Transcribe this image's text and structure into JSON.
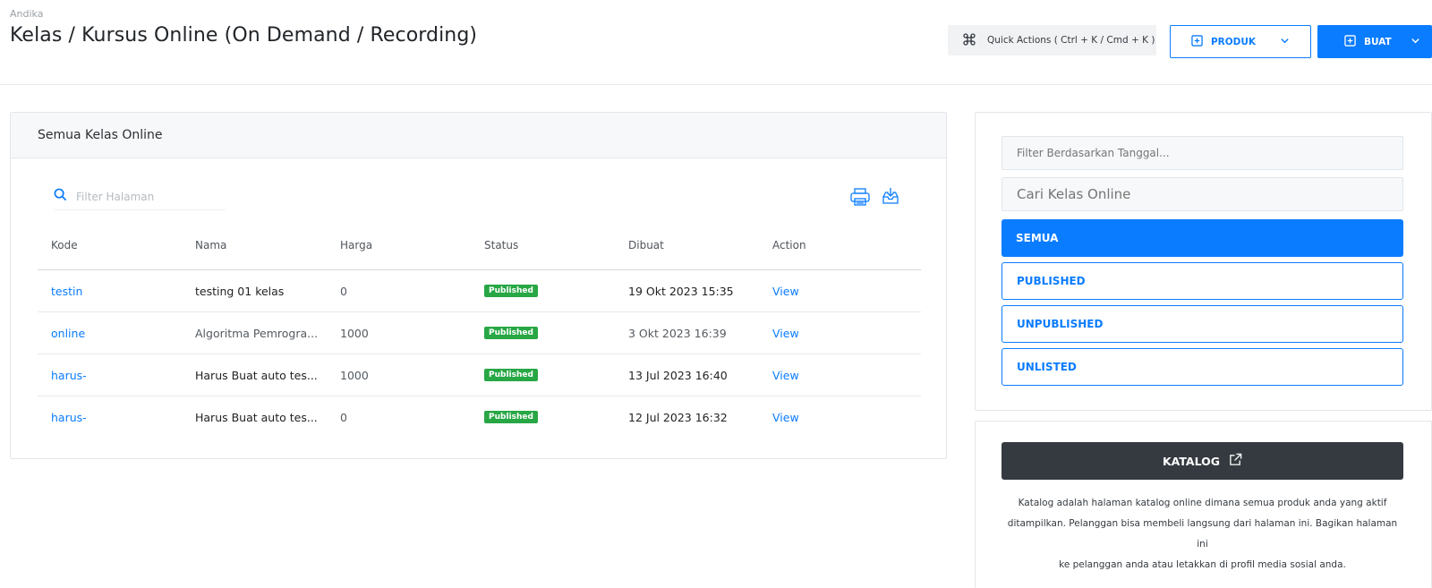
{
  "header": {
    "breadcrumb": "Andika",
    "title": "Kelas / Kursus Online (On Demand / Recording)",
    "quick_actions_label": "Quick Actions ( Ctrl + K / Cmd + K )",
    "produk_label": "PRODUK",
    "buat_label": "BUAT"
  },
  "main": {
    "card_title": "Semua Kelas Online",
    "search_placeholder": "Filter Halaman",
    "columns": [
      "Kode",
      "Nama",
      "Harga",
      "Status",
      "Dibuat",
      "Action"
    ],
    "rows": [
      {
        "kode": "testin",
        "nama": "testing 01 kelas",
        "harga": "0",
        "status": "Published",
        "dibuat": "19 Okt 2023 15:35",
        "action": "View"
      },
      {
        "kode": "online",
        "nama": "Algoritma Pemrogra...",
        "harga": "1000",
        "status": "Published",
        "dibuat": "3 Okt 2023 16:39",
        "action": "View"
      },
      {
        "kode": "harus-",
        "nama": "Harus Buat auto tes...",
        "harga": "1000",
        "status": "Published",
        "dibuat": "13 Jul 2023 16:40",
        "action": "View"
      },
      {
        "kode": "harus-",
        "nama": "Harus Buat auto tes...",
        "harga": "0",
        "status": "Published",
        "dibuat": "12 Jul 2023 16:32",
        "action": "View"
      }
    ]
  },
  "filter": {
    "date_placeholder": "Filter Berdasarkan Tanggal...",
    "search_placeholder": "Cari Kelas Online",
    "options": [
      "SEMUA",
      "PUBLISHED",
      "UNPUBLISHED",
      "UNLISTED"
    ],
    "selected": "SEMUA"
  },
  "katalog": {
    "button_label": "KATALOG",
    "description_lines": [
      "Katalog adalah halaman katalog online dimana semua produk anda yang aktif",
      "ditampilkan. Pelanggan bisa membeli langsung dari halaman ini. Bagikan halaman ini",
      "ke pelanggan anda atau letakkan di profil media sosial anda."
    ]
  },
  "colors": {
    "accent": "#0a7cff",
    "published_badge": "#28a745",
    "katalog_button": "#343a40"
  },
  "icons": [
    "command-icon",
    "plus-square-icon",
    "chevron-down-icon",
    "search-icon",
    "printer-icon",
    "inbox-download-icon",
    "external-link-icon"
  ]
}
